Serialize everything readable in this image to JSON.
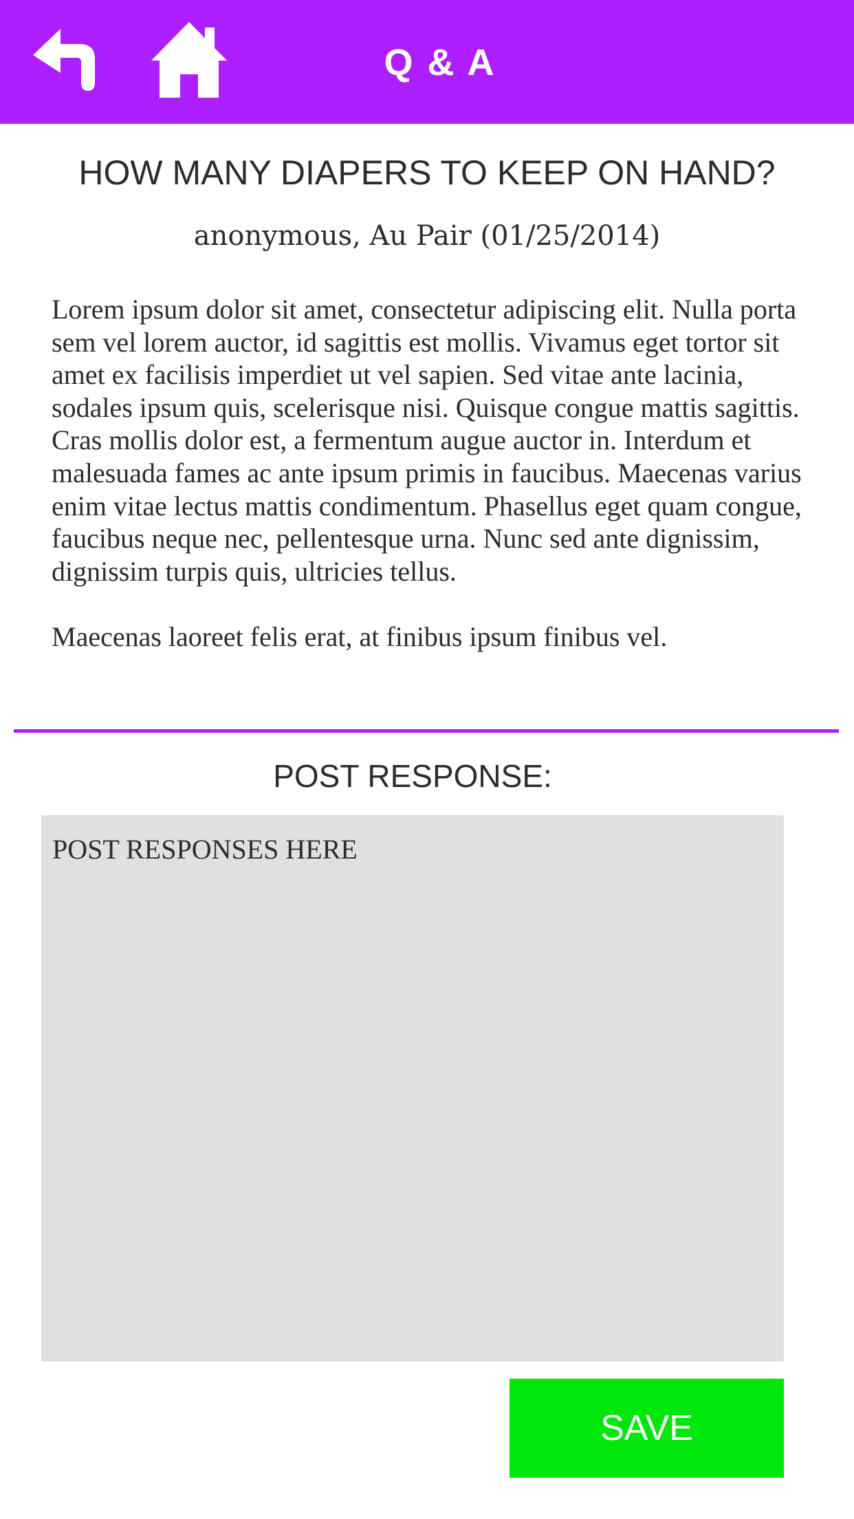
{
  "colors": {
    "accent": "#ad1ffe",
    "text": "#2e2b2b",
    "input_background": "#e1e0e1",
    "save_button": "#00e70b",
    "white": "#ffffff"
  },
  "header": {
    "title": "Q & A",
    "back_icon": "back-arrow-icon",
    "home_icon": "home-icon"
  },
  "question": {
    "title": "HOW MANY DIAPERS TO KEEP ON HAND?",
    "byline": "anonymous, Au Pair (01/25/2014)",
    "paragraphs": [
      "Lorem ipsum dolor sit amet, consectetur adipiscing elit. Nulla porta sem vel lorem auctor, id sagittis est mollis. Vivamus eget tortor sit amet ex facilisis imperdiet ut vel sapien. Sed vitae ante lacinia, sodales ipsum quis, scelerisque nisi. Quisque congue mattis sagittis. Cras mollis dolor est, a fermentum augue auctor in. Interdum et malesuada fames ac ante ipsum primis in faucibus. Maecenas varius enim vitae lectus mattis condimentum. Phasellus eget quam congue, faucibus neque nec, pellentesque urna. Nunc sed ante dignissim, dignissim turpis quis, ultricies tellus.",
      "Maecenas laoreet felis erat, at finibus ipsum finibus vel."
    ]
  },
  "response": {
    "heading": "POST RESPONSE:",
    "placeholder": "POST RESPONSES HERE",
    "value": "",
    "save_label": "SAVE"
  }
}
